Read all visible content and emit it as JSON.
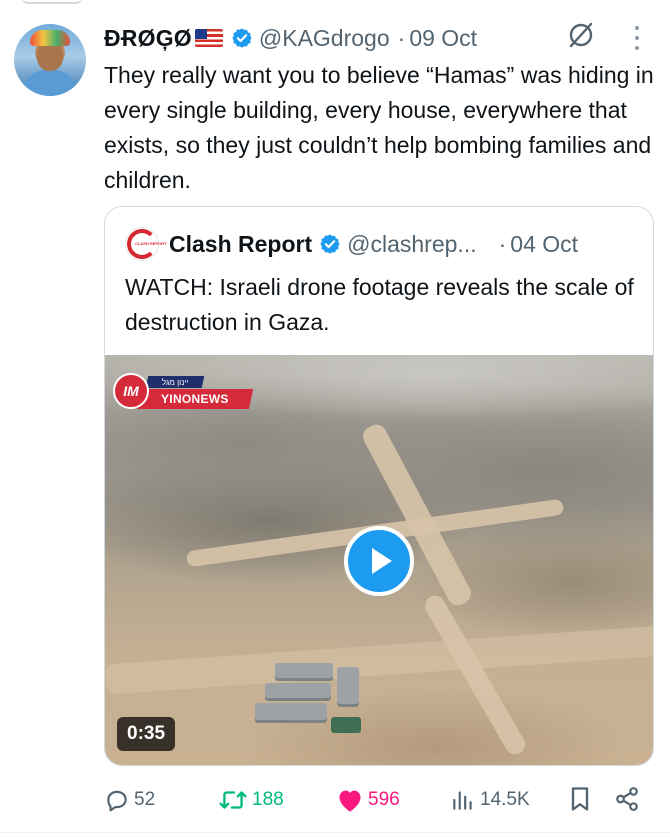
{
  "tweet": {
    "author_name": "ĐɌØĢØ",
    "author_flag": "US flag emoji",
    "author_handle": "@KAGdrogo",
    "separator": "·",
    "date": "09 Oct",
    "text": "They really want you to believe “Hamas” was hiding in every single building, every house, everywhere that exists, so they just couldn’t help bombing families and children."
  },
  "quoted_tweet": {
    "author_name": "Clash Report",
    "author_handle": "@clashrep...",
    "separator": "·",
    "date": "04 Oct",
    "avatar_text": "CLASH REPORT",
    "text": "WATCH: Israeli drone footage reveals the scale of destruction in Gaza.",
    "video": {
      "duration": "0:35",
      "logo_badge": "YINONEWS",
      "logo_mark": "IM",
      "logo_top_text": "יינון מגל"
    }
  },
  "actions": {
    "reply_count": "52",
    "retweet_count": "188",
    "like_count": "596",
    "views_count": "14.5K"
  },
  "icons": [
    "verified-badge-icon",
    "no-post-icon",
    "more-options-icon",
    "play-icon",
    "reply-icon",
    "retweet-icon",
    "heart-icon",
    "views-icon",
    "bookmark-icon",
    "share-icon"
  ],
  "colors": {
    "verified_blue": "#1d9bf0",
    "retweet_green": "#00ba7c",
    "like_pink": "#f91880",
    "secondary_text": "#536471",
    "clash_red": "#d6262e"
  }
}
